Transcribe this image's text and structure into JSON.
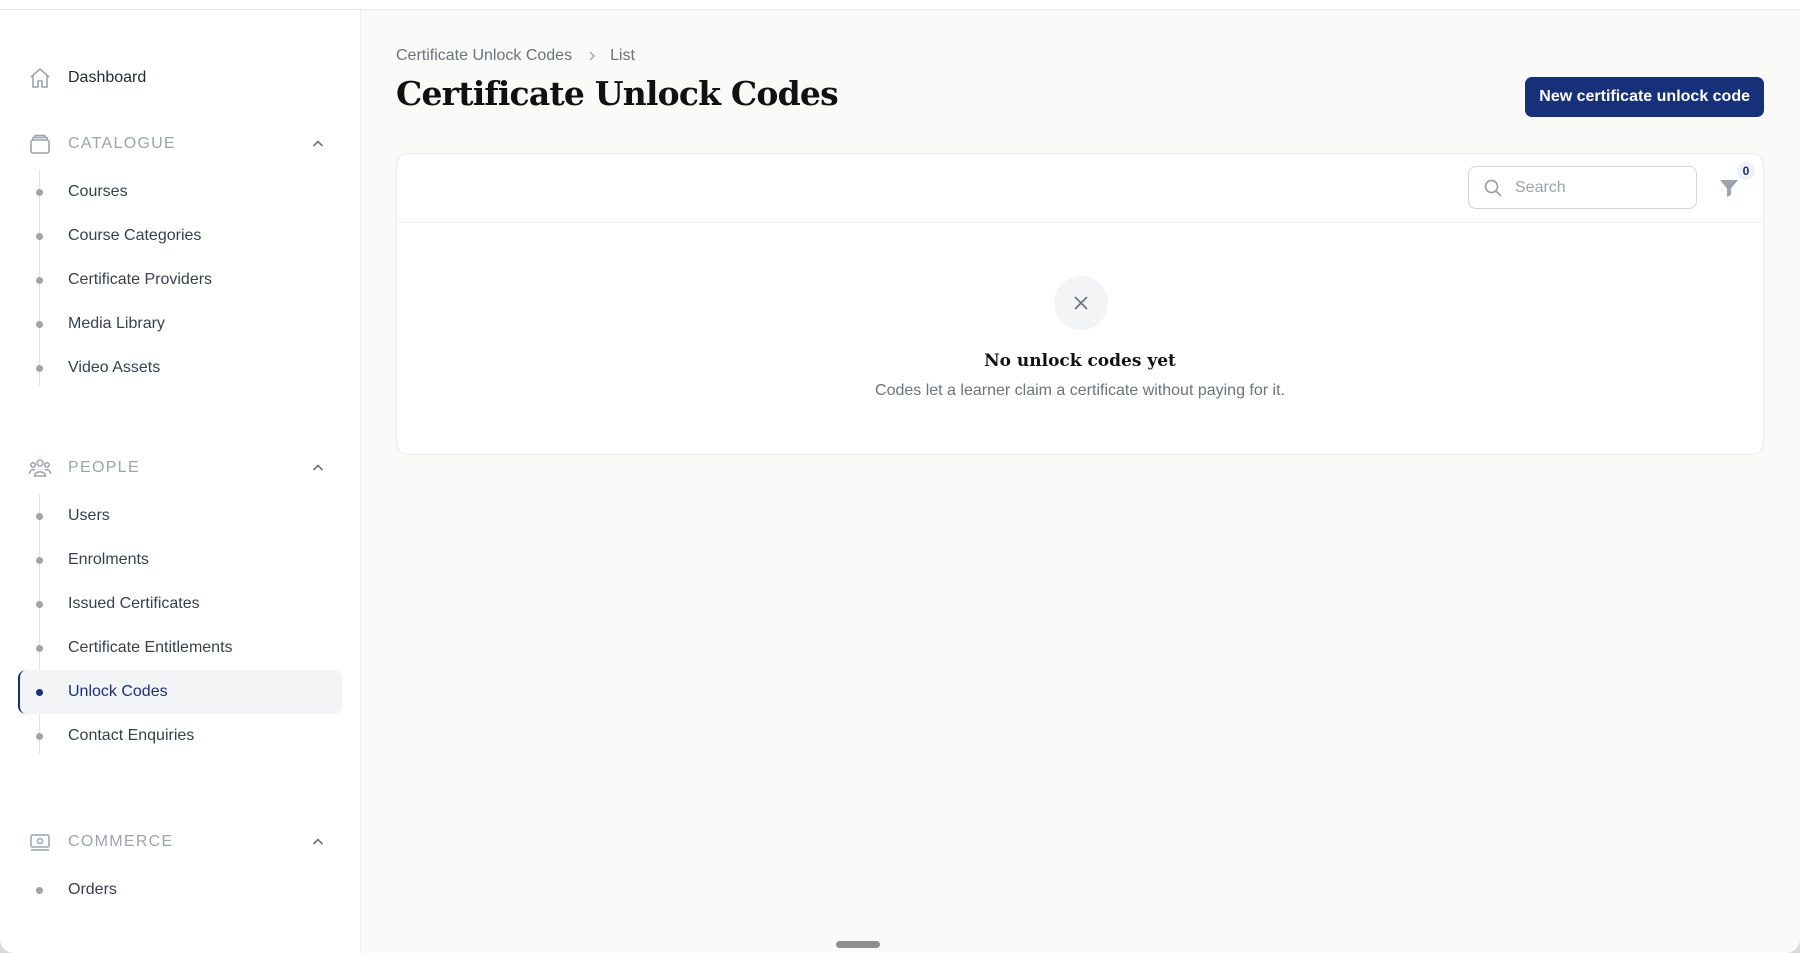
{
  "sidebar": {
    "dashboard": {
      "label": "Dashboard",
      "icon": "home-icon"
    },
    "groups": [
      {
        "label": "CATALOGUE",
        "icon": "archive-icon",
        "items": [
          {
            "label": "Courses"
          },
          {
            "label": "Course Categories"
          },
          {
            "label": "Certificate Providers"
          },
          {
            "label": "Media Library"
          },
          {
            "label": "Video Assets"
          }
        ]
      },
      {
        "label": "PEOPLE",
        "icon": "users-icon",
        "items": [
          {
            "label": "Users"
          },
          {
            "label": "Enrolments"
          },
          {
            "label": "Issued Certificates"
          },
          {
            "label": "Certificate Entitlements"
          },
          {
            "label": "Unlock Codes",
            "active": true
          },
          {
            "label": "Contact Enquiries"
          }
        ]
      },
      {
        "label": "COMMERCE",
        "icon": "banknote-icon",
        "items": [
          {
            "label": "Orders"
          }
        ]
      }
    ]
  },
  "header": {
    "breadcrumb": [
      "Certificate Unlock Codes",
      "List"
    ],
    "title": "Certificate Unlock Codes",
    "new_button_label": "New certificate unlock code"
  },
  "table": {
    "search_placeholder": "Search",
    "filter_count": "0",
    "empty": {
      "title": "No unlock codes yet",
      "description": "Codes let a learner claim a certificate without paying for it."
    }
  },
  "colors": {
    "primary": "#16307a",
    "sidebar_active_bg": "#f3f4f6",
    "page_bg": "#fafaf9"
  }
}
